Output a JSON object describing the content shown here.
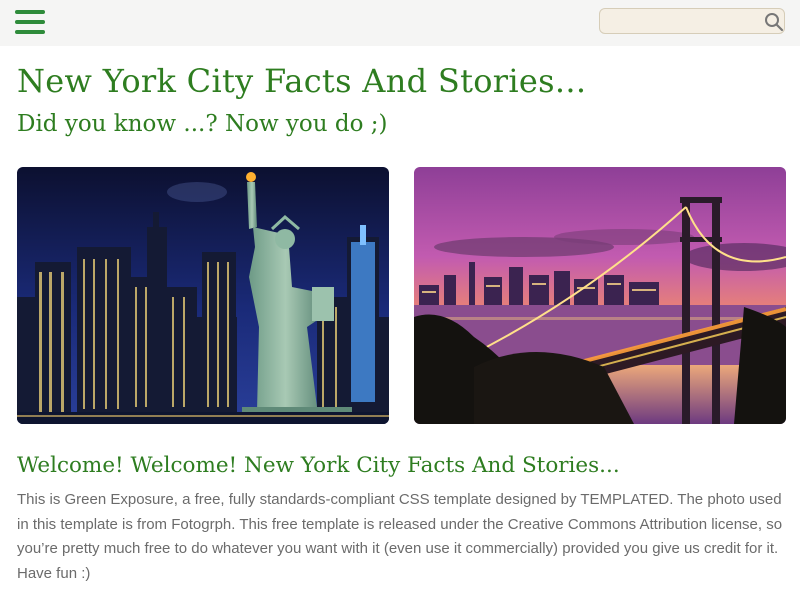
{
  "header": {
    "menu_icon": "hamburger-menu-icon",
    "search": {
      "placeholder": "",
      "icon": "search-icon"
    }
  },
  "main": {
    "title": "New York City Facts And Stories...",
    "subtitle": "Did you know ...? Now you do ;)",
    "images": [
      {
        "subject": "statue-of-liberty-night-skyline"
      },
      {
        "subject": "bridge-sunset-skyline"
      }
    ],
    "section": {
      "title": "Welcome! Welcome! New York City Facts And Stories...",
      "paragraph": "This is Green Exposure, a free, fully standards-compliant CSS template designed by TEMPLATED. The photo used in this template is from Fotogrph. This free template is released under the Creative Commons Attribution license, so you’re pretty much free to do whatever you want with it (even use it commercially) provided you give us credit for it. Have fun :)"
    }
  },
  "colors": {
    "accent_green": "#2e7d20",
    "menu_green": "#2e8b3a",
    "topbar_bg": "#f5f5f4",
    "body_text": "#6b6b6b",
    "search_bg": "#f5efe4"
  }
}
